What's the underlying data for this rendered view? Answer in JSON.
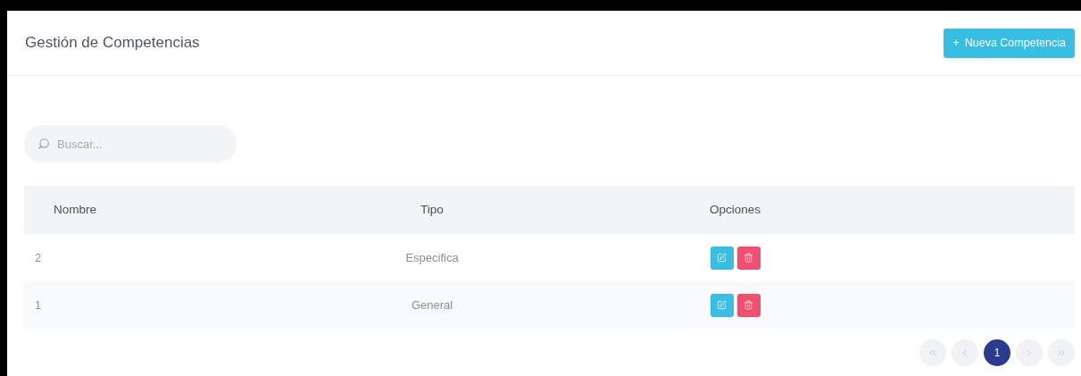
{
  "header": {
    "title": "Gestión de Competencias",
    "add_button": {
      "icon": "+",
      "label": "Nueva Competencia"
    }
  },
  "search": {
    "placeholder": "Buscar..."
  },
  "table": {
    "columns": [
      "Nombre",
      "Tipo",
      "Opciones"
    ],
    "rows": [
      {
        "nombre": "2",
        "tipo": "Especifica"
      },
      {
        "nombre": "1",
        "tipo": "General"
      }
    ]
  },
  "pagination": {
    "pages": [
      {
        "label": "1",
        "selected": true
      }
    ]
  }
}
